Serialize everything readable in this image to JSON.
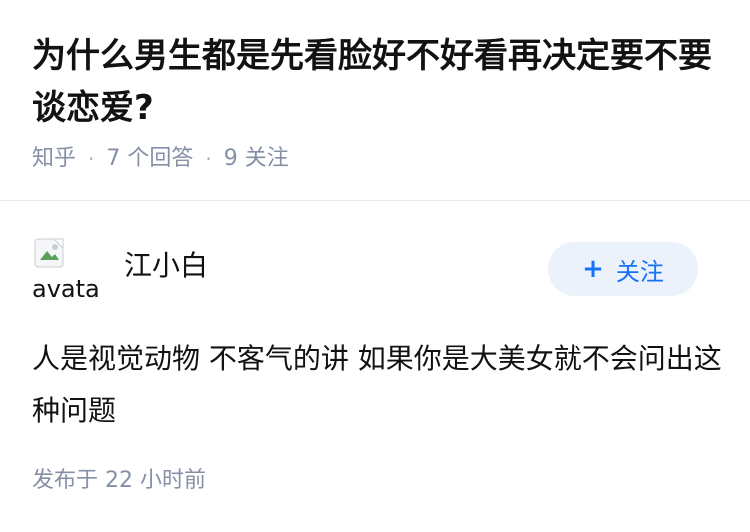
{
  "question": {
    "title": "为什么男生都是先看脸好不好看再决定要不要谈恋爱?",
    "source": "知乎",
    "answers_count": "7 个回答",
    "followers_count": "9 关注"
  },
  "author": {
    "avatar_alt": "avatar",
    "name": "江小白",
    "follow_button": "关注",
    "follow_icon": "plus-icon"
  },
  "answer": {
    "content": "人是视觉动物 不客气的讲 如果你是大美女就不会问出这种问题",
    "post_time": "发布于 22 小时前"
  },
  "colors": {
    "text_primary": "#121212",
    "text_secondary": "#8590a6",
    "accent": "#1772f6",
    "button_bg": "#ebf2fc",
    "divider": "#ebebeb"
  }
}
